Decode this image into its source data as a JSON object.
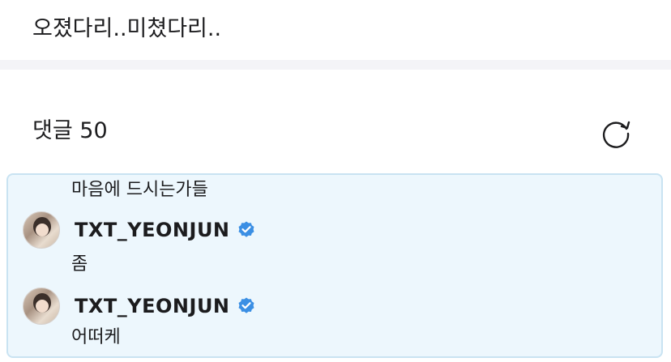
{
  "post": {
    "text": "오졌다리..미쳤다리.."
  },
  "comments": {
    "header": "댓글 50",
    "refresh_icon": "refresh-icon",
    "thread": {
      "items": [
        {
          "type": "text",
          "text": "마음에 드시는가들"
        },
        {
          "type": "author",
          "name": "TXT_YEONJUN",
          "verified": true
        },
        {
          "type": "text",
          "text": "좀"
        },
        {
          "type": "author",
          "name": "TXT_YEONJUN",
          "verified": true
        },
        {
          "type": "text",
          "text": "어떠케"
        }
      ]
    }
  },
  "colors": {
    "panel_background": "#edf7fd",
    "panel_border": "#c9e3f2",
    "verified_badge": "#3b8fe4",
    "divider": "#f4f4f7"
  }
}
